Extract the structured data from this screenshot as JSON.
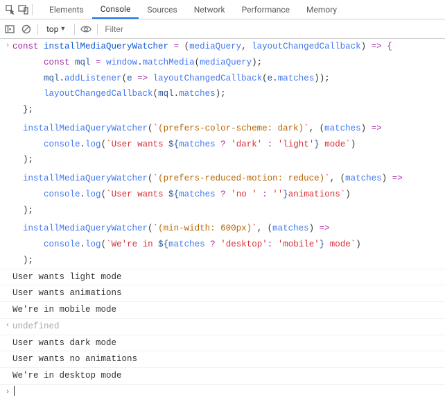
{
  "tabs": {
    "elements": "Elements",
    "console": "Console",
    "sources": "Sources",
    "network": "Network",
    "performance": "Performance",
    "memory": "Memory",
    "active": "Console"
  },
  "toolbar": {
    "context": "top",
    "filter_placeholder": "Filter"
  },
  "code": {
    "l1": {
      "const": "const",
      "name": "installMediaQueryWatcher",
      "eq": " = ",
      "p1": "mediaQuery",
      "p2": "layoutChangedCallback",
      "arrow": " => {"
    },
    "l2": {
      "indent": "      ",
      "const": "const",
      "name": "mql",
      "eq": " = ",
      "win": "window",
      "m": "matchMedia",
      "arg": "mediaQuery"
    },
    "l3": {
      "indent": "      ",
      "obj": "mql",
      "m": "addListener",
      "p": "e",
      "arrow": " => ",
      "cb": "layoutChangedCallback",
      "e": "e",
      "prop": "matches"
    },
    "l4": {
      "indent": "      ",
      "cb": "layoutChangedCallback",
      "obj": "mql",
      "prop": "matches"
    },
    "l5": {
      "indent": "  ",
      "close": "};"
    },
    "blank": "",
    "c1": {
      "indent": "  ",
      "fn": "installMediaQueryWatcher",
      "q": "(prefers-color-scheme: dark)",
      "p": "matches",
      "arrow": " =>"
    },
    "c1b": {
      "indent": "      ",
      "obj": "console",
      "m": "log",
      "s1": "User wants ",
      "expr": "matches",
      "t": "'dark'",
      "f": "'light'",
      "s2": " mode"
    },
    "c1c": {
      "indent": "  ",
      "close": ");"
    },
    "c2": {
      "indent": "  ",
      "fn": "installMediaQueryWatcher",
      "q": "(prefers-reduced-motion: reduce)",
      "p": "matches",
      "arrow": " =>"
    },
    "c2b": {
      "indent": "      ",
      "obj": "console",
      "m": "log",
      "s1": "User wants ",
      "expr": "matches",
      "t": "'no '",
      "f": "''",
      "s2": "animations"
    },
    "c2c": {
      "indent": "  ",
      "close": ");"
    },
    "c3": {
      "indent": "  ",
      "fn": "installMediaQueryWatcher",
      "q": "(min-width: 600px)",
      "p": "matches",
      "arrow": " =>"
    },
    "c3b": {
      "indent": "      ",
      "obj": "console",
      "m": "log",
      "s1": "We're in ",
      "expr": "matches",
      "t": "'desktop'",
      "f": "'mobile'",
      "s2": " mode"
    },
    "c3c": {
      "indent": "  ",
      "close": ");"
    }
  },
  "logs": {
    "o1": "User wants light mode",
    "o2": "User wants animations",
    "o3": "We're in mobile mode",
    "ret": "undefined",
    "o4": "User wants dark mode",
    "o5": "User wants no animations",
    "o6": "We're in desktop mode"
  }
}
